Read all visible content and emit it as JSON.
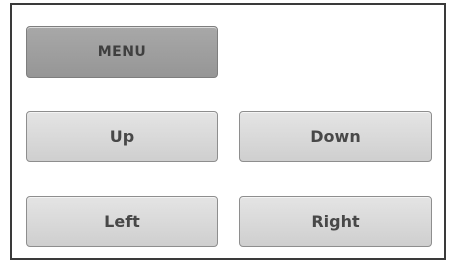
{
  "controls": {
    "menu_label": "MENU",
    "up_label": "Up",
    "down_label": "Down",
    "left_label": "Left",
    "right_label": "Right"
  },
  "colors": {
    "menu_button": "#a0a0a0",
    "button": "#d9d9d9",
    "border": "#3a3a3a"
  }
}
